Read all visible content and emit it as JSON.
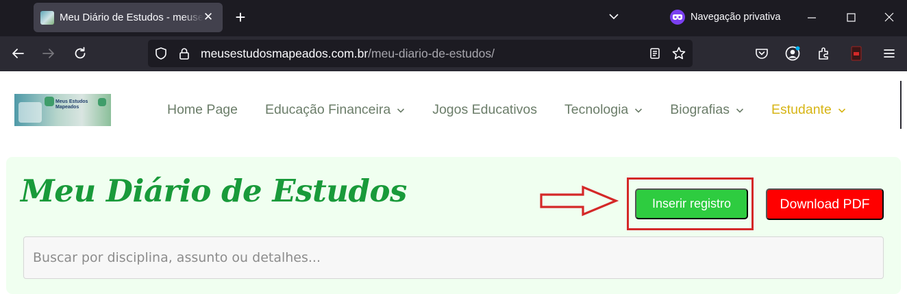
{
  "browser": {
    "tab": {
      "title": "Meu Diário de Estudos - meusestudosmapeados.com.br",
      "favicon": "site-favicon"
    },
    "new_tab_label": "+",
    "private_label": "Navegação privativa",
    "url": {
      "host": "meusestudosmapeados.com.br",
      "path": "/meu-diario-de-estudos/"
    },
    "colors": {
      "tabstrip": "#1c1b22",
      "toolbar": "#2b2a33",
      "private_accent": "#7a3ff0"
    }
  },
  "site": {
    "logo_alt": "Meus Estudos Mapeados",
    "nav": [
      {
        "label": "Home Page",
        "dropdown": false,
        "active": false
      },
      {
        "label": "Educação Financeira",
        "dropdown": true,
        "active": false
      },
      {
        "label": "Jogos Educativos",
        "dropdown": false,
        "active": false
      },
      {
        "label": "Tecnologia",
        "dropdown": true,
        "active": false
      },
      {
        "label": "Biografias",
        "dropdown": true,
        "active": false
      },
      {
        "label": "Estudante",
        "dropdown": true,
        "active": true
      }
    ],
    "colors": {
      "nav_text": "#6b7d69",
      "nav_active": "#d7b516"
    }
  },
  "diary": {
    "title": "Meu Diário de Estudos",
    "insert_button": "Inserir registro",
    "pdf_button": "Download PDF",
    "search_placeholder": "Buscar por disciplina, assunto ou detalhes...",
    "search_value": "",
    "colors": {
      "title": "#199a3a",
      "insert": "#2ecc40",
      "pdf": "#ff0000",
      "panel": "#f0fff0",
      "annotation": "#d42828"
    }
  }
}
